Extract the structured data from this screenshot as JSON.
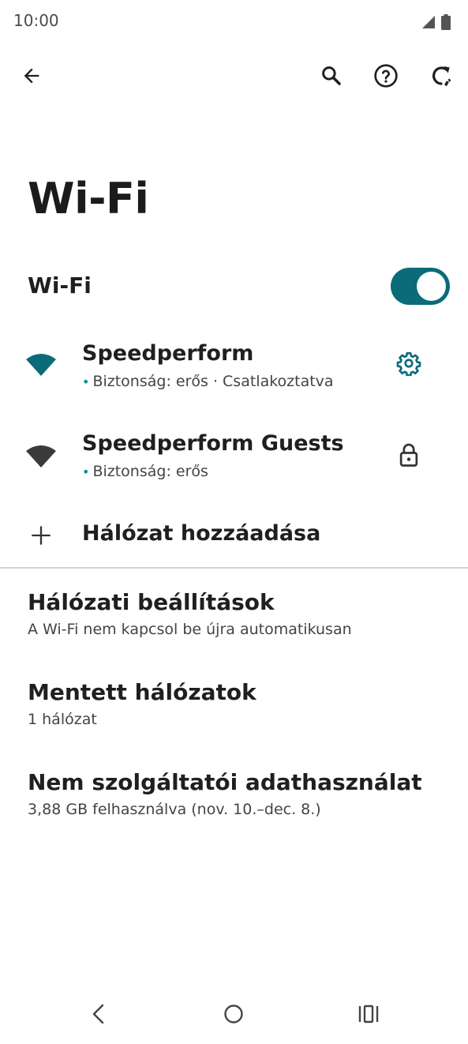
{
  "status_bar": {
    "time": "10:00",
    "icons": [
      "signal-icon",
      "battery-icon"
    ]
  },
  "toolbar": {
    "icons": [
      "back-arrow-icon",
      "search-icon",
      "help-icon",
      "reset-network-icon"
    ]
  },
  "page": {
    "title": "Wi-Fi"
  },
  "wifi_toggle": {
    "label": "Wi-Fi",
    "state": "on"
  },
  "networks": [
    {
      "name": "Speedperform",
      "status": "Biztonság: erős · Csatlakoztatva",
      "action_icon": "gear-icon"
    },
    {
      "name": "Speedperform Guests",
      "status": "Biztonság: erős",
      "action_icon": "lock-icon"
    }
  ],
  "add_network": {
    "label": "Hálózat hozzáadása"
  },
  "preferences": [
    {
      "title": "Hálózati beállítások",
      "summary": "A Wi-Fi nem kapcsol be újra automatikusan"
    },
    {
      "title": "Mentett hálózatok",
      "summary": "1 hálózat"
    },
    {
      "title": "Nem szolgáltatói adathasználat",
      "summary": "3,88 GB felhasználva (nov. 10.–dec. 8.)"
    }
  ],
  "nav_bar": {
    "icons": [
      "nav-back-icon",
      "nav-home-icon",
      "nav-recents-icon"
    ]
  },
  "colors": {
    "accent": "#0b6b78",
    "text": "#1f1f1f",
    "subtext": "#444444",
    "divider": "#d5d5d5"
  }
}
